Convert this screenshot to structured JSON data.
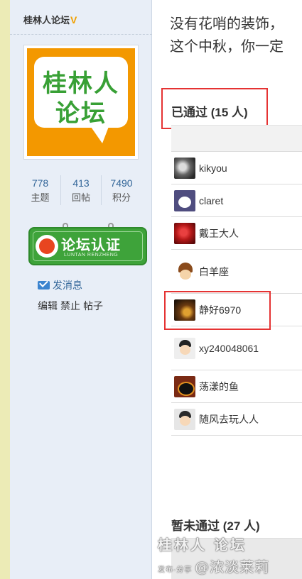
{
  "sidebar": {
    "username": "桂林人论坛",
    "vip_badge": "V",
    "avatar": {
      "line1": "桂林人",
      "line2": "论坛"
    },
    "stats": [
      {
        "value": "778",
        "label": "主题"
      },
      {
        "value": "413",
        "label": "回帖"
      },
      {
        "value": "7490",
        "label": "积分"
      }
    ],
    "cert_badge": {
      "text": "论坛认证",
      "subtext": "LUNTAN RENZHENG"
    },
    "send_message": "发消息",
    "admin_links": [
      "编辑",
      "禁止",
      "帖子"
    ]
  },
  "main": {
    "intro_line1": "没有花哨的装饰，",
    "intro_line2": "这个中秋，你一定",
    "approved_title": "已通过 (15 人)",
    "pending_title": "暂未通过 (27 人)",
    "members": [
      {
        "name": "kikyou"
      },
      {
        "name": "claret"
      },
      {
        "name": "戴王大人"
      },
      {
        "name": "白羊座"
      },
      {
        "name": "静好6970"
      },
      {
        "name": "xy240048061"
      },
      {
        "name": "荡漾的鱼"
      },
      {
        "name": "随风去玩人人"
      }
    ]
  },
  "watermark": {
    "line1": "桂林人 论坛",
    "line2_small": "发布·分享",
    "line2_big": "@浓淡莱莉"
  },
  "colors": {
    "highlight": "#e53333",
    "link": "#336699",
    "sidebar_bg": "#e8eef7",
    "brand_orange": "#f39800",
    "brand_green": "#38a035"
  }
}
